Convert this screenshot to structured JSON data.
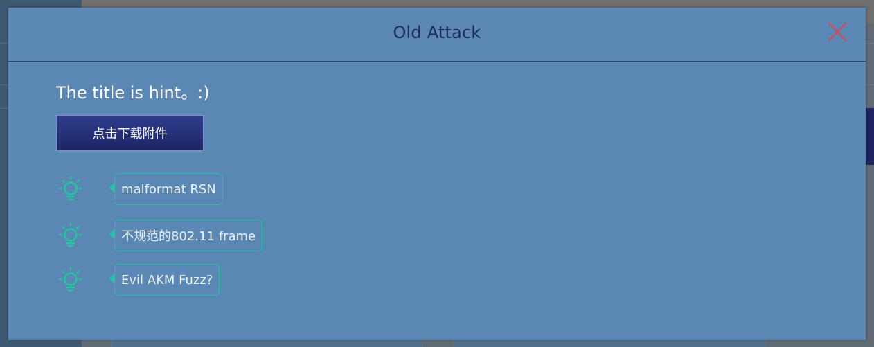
{
  "modal": {
    "title": "Old Attack",
    "close_icon": "close-icon"
  },
  "body": {
    "heading": "The title is hint。:)",
    "download_label": "点击下载附件"
  },
  "hints": [
    {
      "icon": "lightbulb-icon",
      "text": "malformat RSN"
    },
    {
      "icon": "lightbulb-icon",
      "text": "不规范的802.11 frame"
    },
    {
      "icon": "lightbulb-icon",
      "text": "Evil AKM Fuzz?"
    }
  ],
  "colors": {
    "modal_background": "#5a87b3",
    "title": "#1e2a5c",
    "close": "#d04c5c",
    "hint_accent": "#22c6a0",
    "button": "#242e78"
  }
}
